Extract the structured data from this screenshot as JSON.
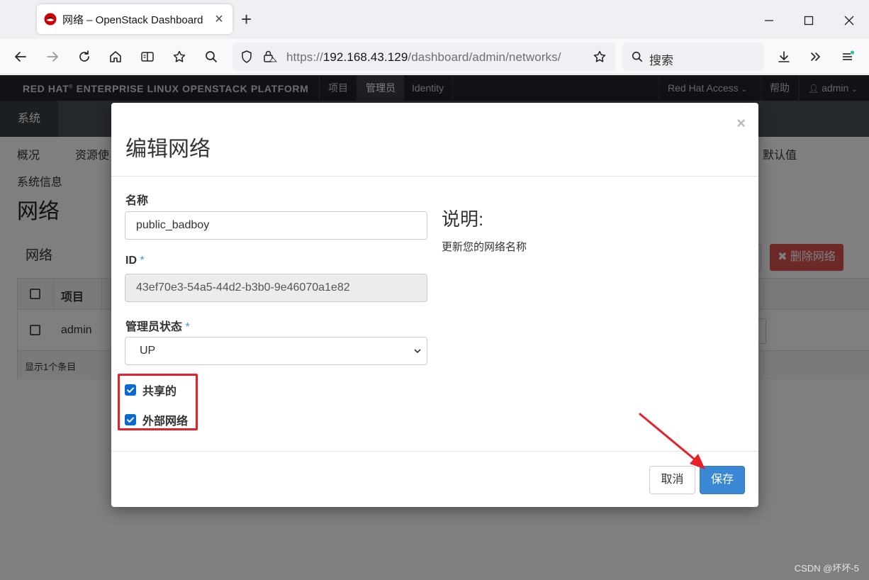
{
  "browser": {
    "tab_title": "网络 – OpenStack Dashboard",
    "url_prefix": "https://",
    "url_host": "192.168.43.129",
    "url_path": "/dashboard/admin/networks/",
    "search_placeholder": "搜索"
  },
  "os_header": {
    "brand": "RED HAT",
    "brand_rest": " ENTERPRISE LINUX OPENSTACK PLATFORM",
    "nav": [
      "项目",
      "管理员",
      "Identity"
    ],
    "red_hat_access": "Red Hat Access",
    "help": "帮助",
    "user": "admin"
  },
  "page": {
    "subnav_active": "系统",
    "nav_items": [
      "概况",
      "资源使",
      "默认值",
      "系统信息"
    ],
    "title": "网络",
    "panel_title": "网络",
    "delete_button": "删除网络",
    "table_headers": [
      "项目"
    ],
    "table_rows": [
      [
        "admin"
      ]
    ],
    "footer": "显示1个条目"
  },
  "modal": {
    "title": "编辑网络",
    "close": "×",
    "name_label": "名称",
    "name_value": "public_badboy",
    "id_label": "ID",
    "id_value": "43ef70e3-54a5-44d2-b3b0-9e46070a1e82",
    "admin_state_label": "管理员状态",
    "admin_state_value": "UP",
    "shared_label": "共享的",
    "external_label": "外部网络",
    "help_title": "说明:",
    "help_text": "更新您的网络名称",
    "cancel": "取消",
    "save": "保存",
    "required_mark": "*"
  },
  "watermark": "CSDN @坏坏-5",
  "colors": {
    "accent": "#3a87d3",
    "danger": "#d9534f",
    "highlight": "#e8202a"
  }
}
